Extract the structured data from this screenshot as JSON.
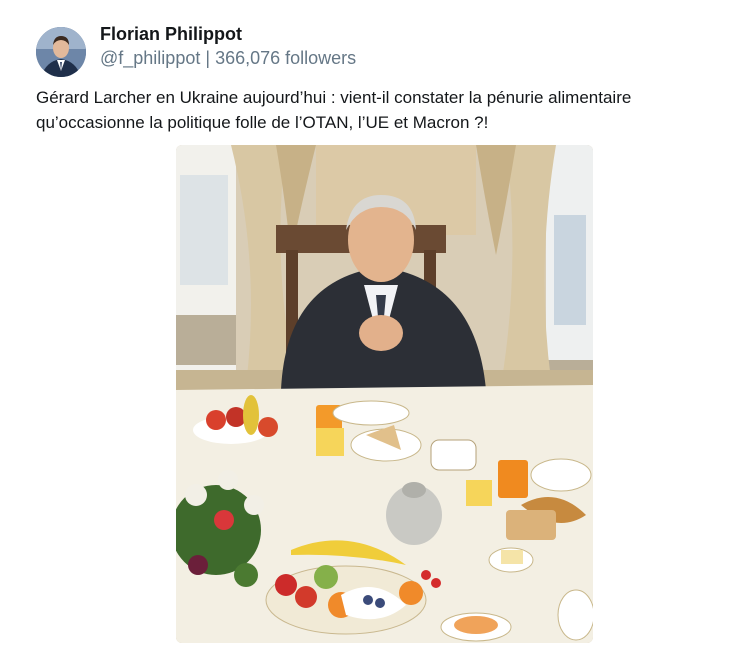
{
  "author": {
    "name": "Florian Philippot",
    "handle": "@f_philippot",
    "separator": "|",
    "followers": "366,076 followers"
  },
  "post": {
    "text_line1": "Gérard Larcher en Ukraine aujourd’hui : vient-il constater la pénurie alimentaire",
    "text_line2": "qu’occasionne la politique folle de l’OTAN, l’UE et Macron ?!"
  },
  "colors": {
    "text": "#14171a",
    "muted": "#657786",
    "background": "#ffffff"
  },
  "icons": {
    "avatar": "profile-photo"
  }
}
